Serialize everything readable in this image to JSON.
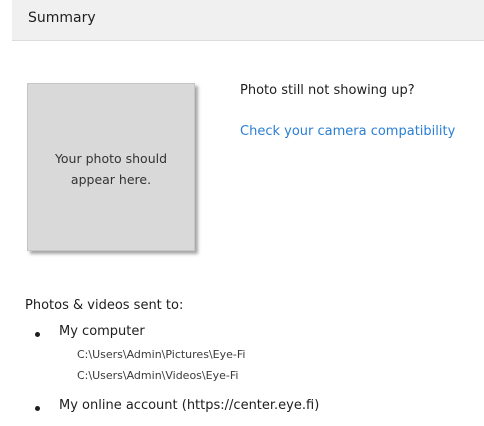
{
  "header": {
    "title": "Summary"
  },
  "photo_placeholder": {
    "line1": "Your photo should",
    "line2": "appear here."
  },
  "help": {
    "title": "Photo still not showing up?",
    "link": "Check your camera compatibility"
  },
  "destinations": {
    "title": "Photos & videos sent to:",
    "items": [
      {
        "label": "My computer",
        "paths": [
          "C:\\Users\\Admin\\Pictures\\Eye-Fi",
          "C:\\Users\\Admin\\Videos\\Eye-Fi"
        ]
      },
      {
        "label": "My online account (https://center.eye.fi)",
        "paths": []
      }
    ]
  },
  "colors": {
    "header_bg": "#f0f0f0",
    "placeholder_bg": "#d9d9d9",
    "link": "#2a7fd4"
  }
}
